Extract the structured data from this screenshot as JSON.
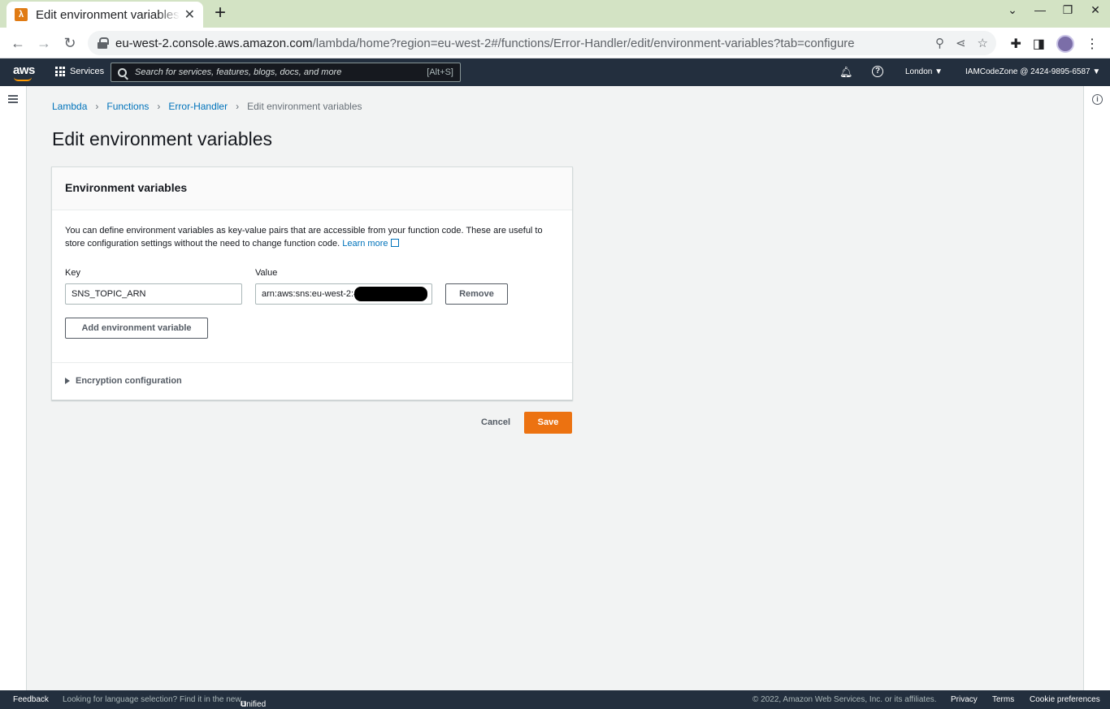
{
  "browser": {
    "tab_title": "Edit environment variables",
    "tab_icon": "aws-lambda-favicon",
    "new_tab": "+",
    "url_host": "eu-west-2.console.aws.amazon.com",
    "url_path": "/lambda/home?region=eu-west-2#/functions/Error-Handler/edit/environment-variables?tab=configure"
  },
  "aws_nav": {
    "logo": "aws",
    "services_label": "Services",
    "search_placeholder": "Search for services, features, blogs, docs, and more",
    "search_shortcut": "[Alt+S]",
    "region": "London ▼",
    "account": "IAMCodeZone @ 2424-9895-6587 ▼"
  },
  "breadcrumb": {
    "items": [
      "Lambda",
      "Functions",
      "Error-Handler"
    ],
    "current": "Edit environment variables"
  },
  "page_title": "Edit environment variables",
  "panel": {
    "title": "Environment variables",
    "description": "You can define environment variables as key-value pairs that are accessible from your function code. These are useful to store configuration settings without the need to change function code.",
    "learn_more": "Learn more",
    "key_label": "Key",
    "value_label": "Value",
    "key_value": "SNS_TOPIC_ARN",
    "value_value": "arn:aws:sns:eu-west-2:4",
    "remove_label": "Remove",
    "add_label": "Add environment variable",
    "encryption_label": "Encryption configuration"
  },
  "actions": {
    "cancel": "Cancel",
    "save": "Save"
  },
  "footer": {
    "feedback": "Feedback",
    "language_text": "Looking for language selection? Find it in the new",
    "unified_settings": "Unified Settings",
    "copyright": "© 2022, Amazon Web Services, Inc. or its affiliates.",
    "privacy": "Privacy",
    "terms": "Terms",
    "cookie": "Cookie preferences"
  },
  "colors": {
    "aws_nav_bg": "#232f3e",
    "primary_button": "#ec7211",
    "link": "#0073bb"
  }
}
